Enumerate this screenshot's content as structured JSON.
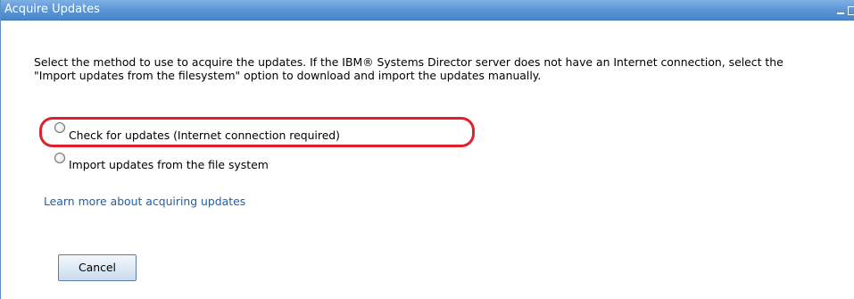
{
  "window": {
    "title": "Acquire Updates"
  },
  "description": "Select the method to use to acquire the updates. If the IBM® Systems Director server does not have an Internet connection, select the \"Import updates from the filesystem\" option to download and import the updates manually.",
  "options": [
    {
      "label": "Check for updates (Internet connection required)",
      "selected": false,
      "highlighted": true
    },
    {
      "label": "Import updates from the file system",
      "selected": false,
      "highlighted": false
    }
  ],
  "link": {
    "text": "Learn more about acquiring updates"
  },
  "buttons": {
    "cancel_label": "Cancel"
  },
  "colors": {
    "titlebar": "#5c96d6",
    "highlight_ring": "#e2202a",
    "link": "#1f5fa8"
  }
}
